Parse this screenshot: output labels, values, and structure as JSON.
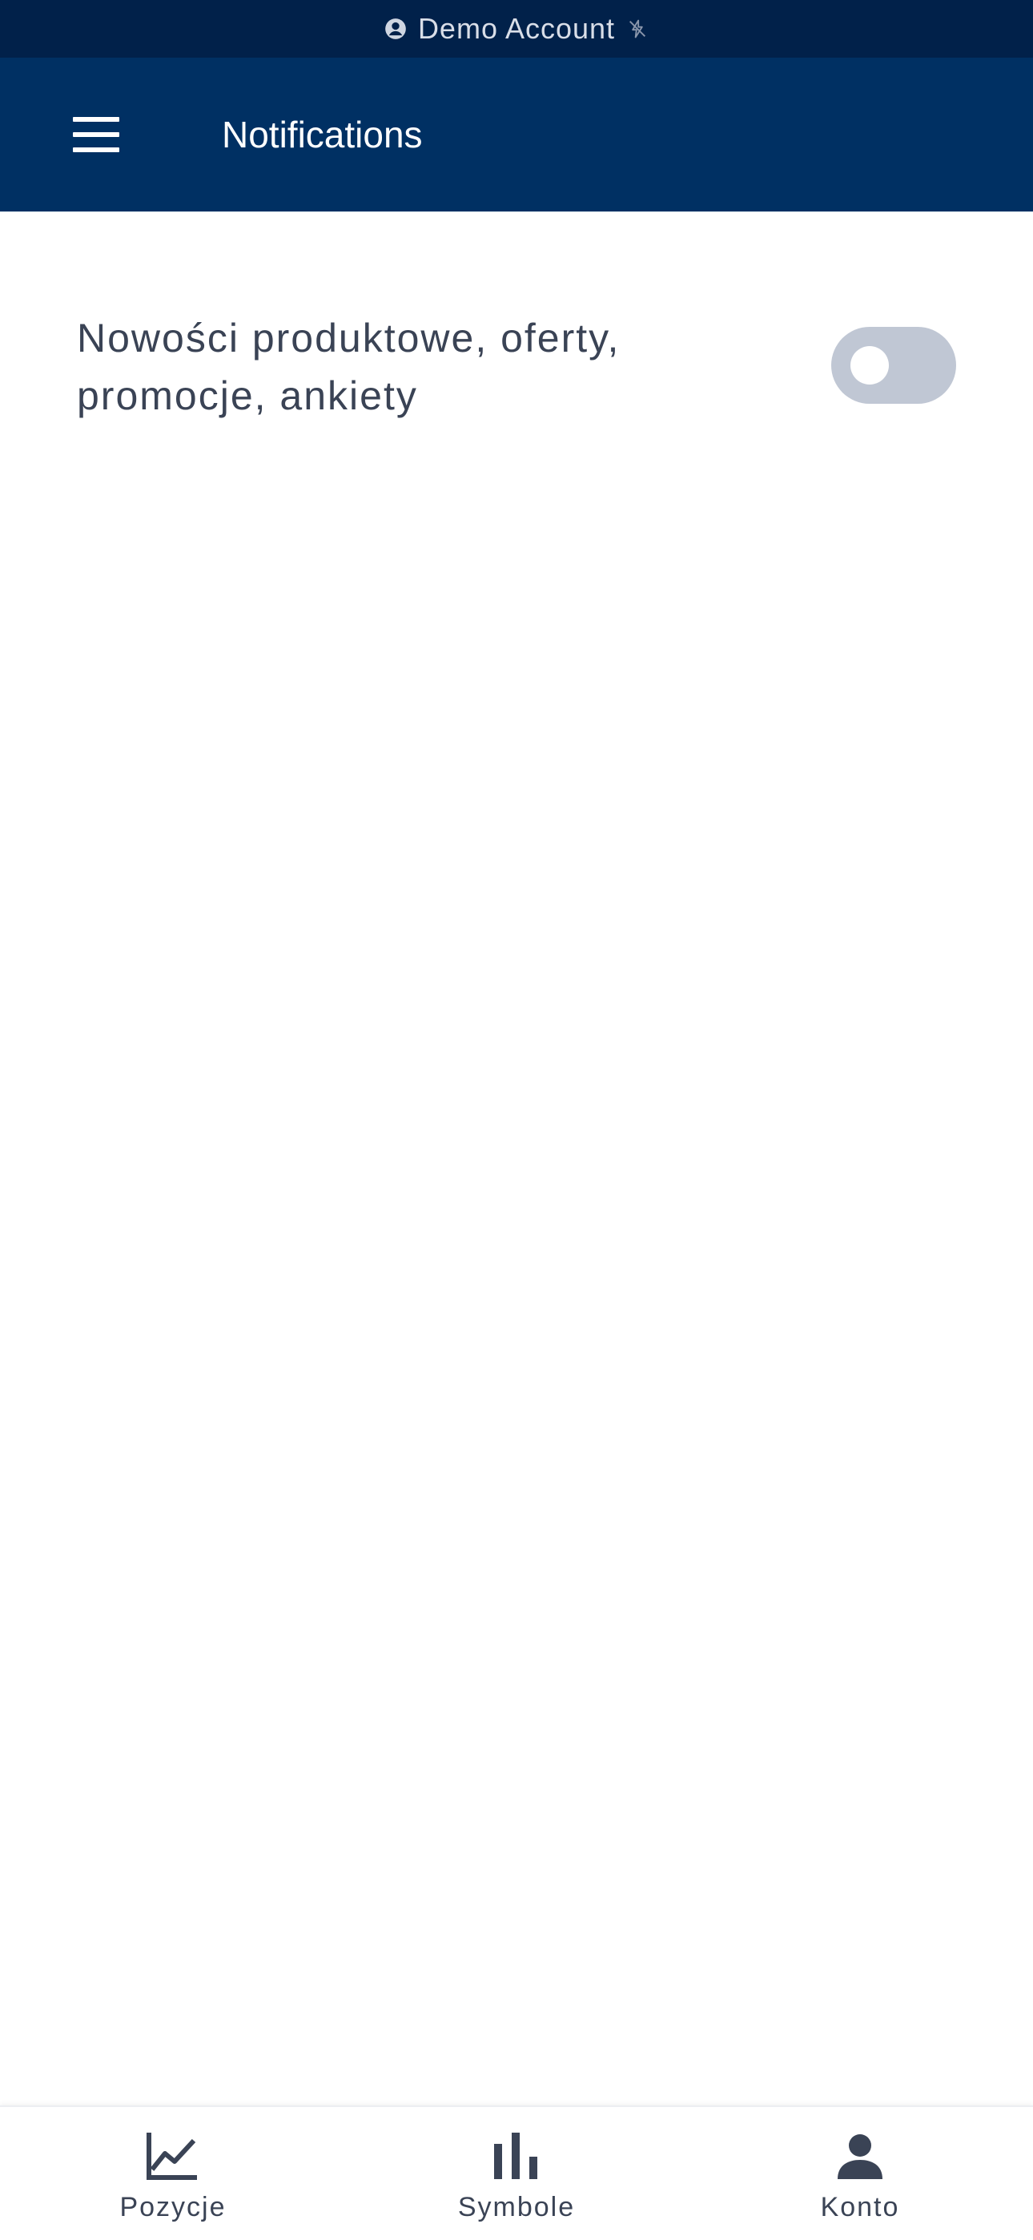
{
  "status_strip": {
    "account_label": "Demo Account",
    "account_icon": "account-circle-icon",
    "connection_icon": "offline-bolt-icon"
  },
  "app_bar": {
    "title": "Notifications",
    "menu_icon": "hamburger-menu-icon"
  },
  "settings": [
    {
      "label": "Nowości produktowe, oferty, promocje, ankiety",
      "enabled": false
    }
  ],
  "bottom_nav": {
    "items": [
      {
        "label": "Pozycje",
        "icon": "line-chart-icon"
      },
      {
        "label": "Symbole",
        "icon": "bar-chart-icon"
      },
      {
        "label": "Konto",
        "icon": "person-icon"
      }
    ]
  },
  "colors": {
    "status_bar_bg": "#01214a",
    "app_bar_bg": "#003063",
    "toggle_off": "#c0c7d4",
    "text_primary": "#3a4355"
  }
}
